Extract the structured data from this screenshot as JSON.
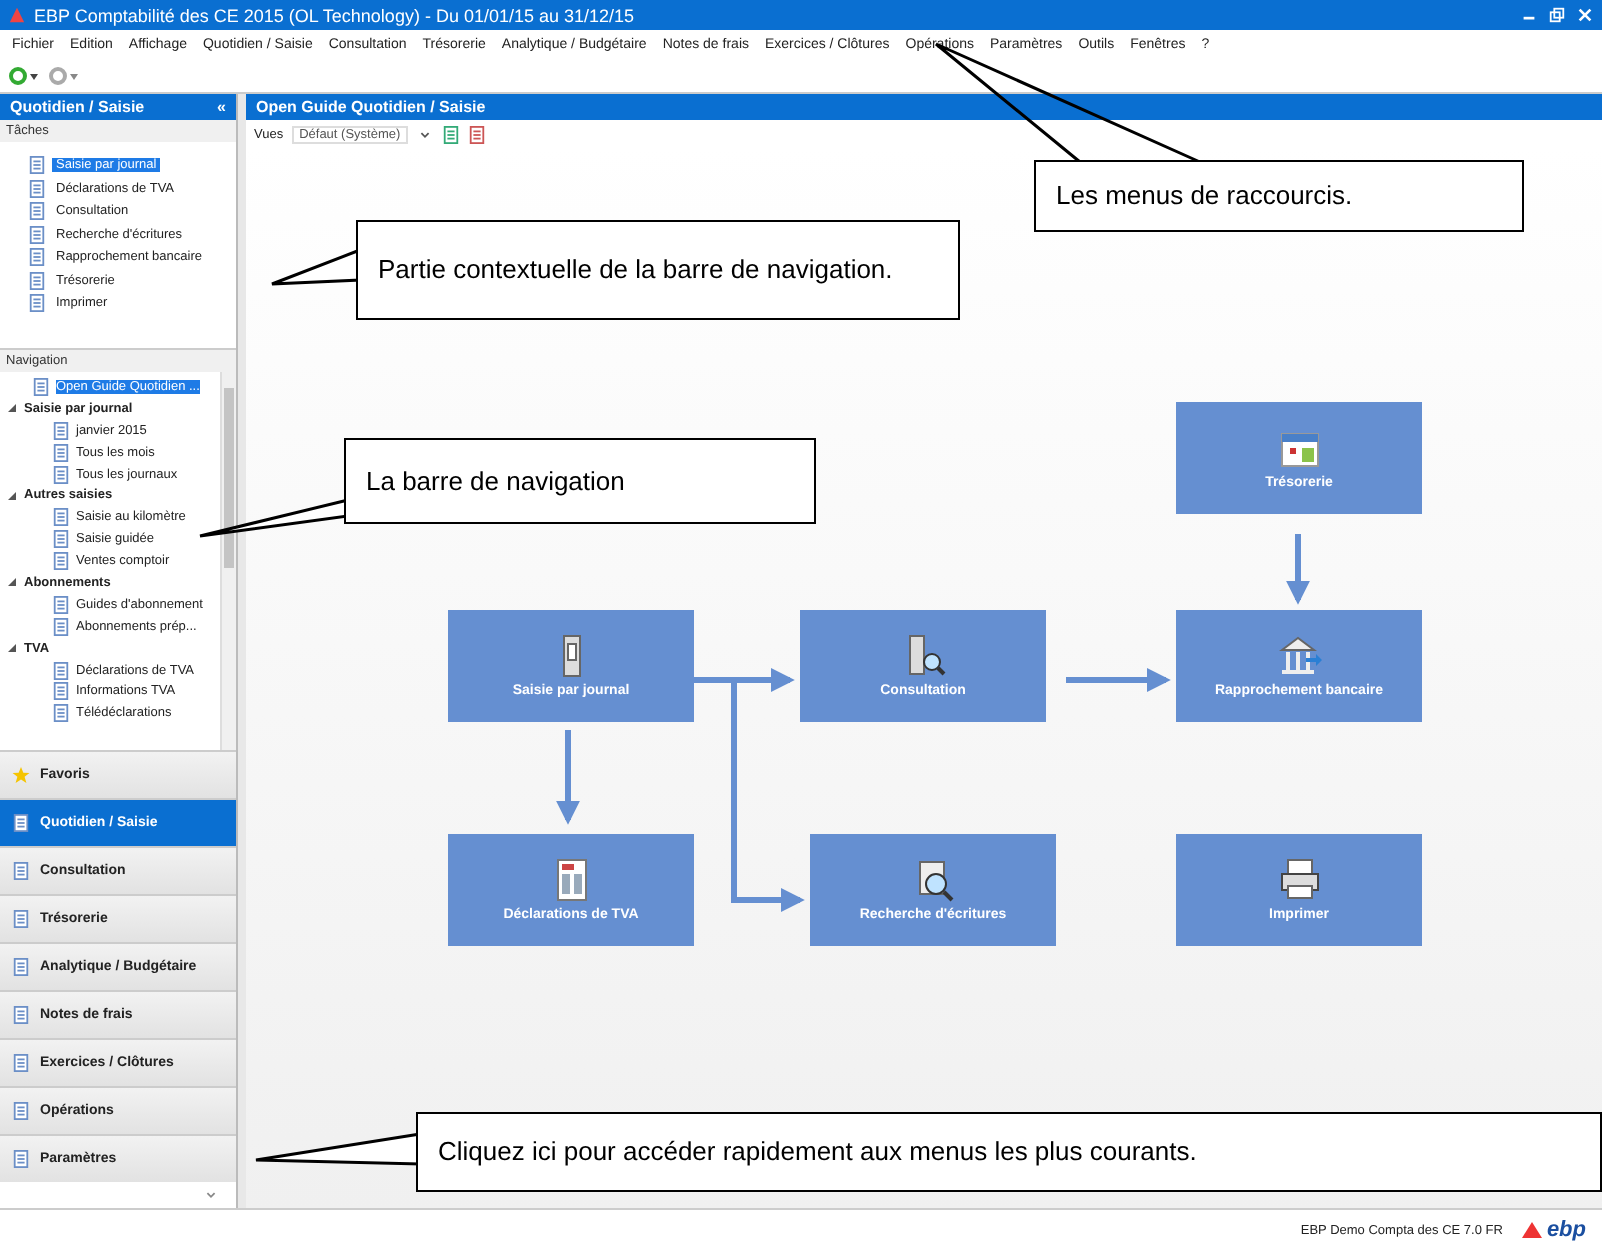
{
  "window": {
    "title": "EBP Comptabilité des CE 2015 (OL Technology) - Du 01/01/15 au 31/12/15"
  },
  "menu": [
    "Fichier",
    "Edition",
    "Affichage",
    "Quotidien / Saisie",
    "Consultation",
    "Trésorerie",
    "Analytique / Budgétaire",
    "Notes de frais",
    "Exercices / Clôtures",
    "Opérations",
    "Paramètres",
    "Outils",
    "Fenêtres",
    "?"
  ],
  "sidebar": {
    "title": "Quotidien / Saisie",
    "collapse": "«",
    "tasks_label": "Tâches",
    "tasks": [
      {
        "label": "Saisie par journal",
        "selected": true
      },
      {
        "label": "Déclarations de TVA",
        "selected": false
      },
      {
        "label": "Consultation",
        "selected": false
      },
      {
        "label": "Recherche d'écritures",
        "selected": false
      },
      {
        "label": "Rapprochement bancaire",
        "selected": false
      },
      {
        "label": "Trésorerie",
        "selected": false
      },
      {
        "label": "Imprimer",
        "selected": false
      }
    ],
    "navigation_label": "Navigation",
    "tree": [
      {
        "label": "Open Guide Quotidien ...",
        "selected": true
      },
      {
        "label": "Saisie par journal",
        "expanded": true,
        "selected": false,
        "children": [
          {
            "label": "janvier 2015",
            "selected": false
          },
          {
            "label": "Tous les mois",
            "selected": false
          },
          {
            "label": "Tous les journaux",
            "selected": false
          }
        ]
      },
      {
        "label": "Autres saisies",
        "expanded": true,
        "selected": false,
        "children": [
          {
            "label": "Saisie au kilomètre",
            "selected": false
          },
          {
            "label": "Saisie guidée",
            "selected": false
          },
          {
            "label": "Ventes comptoir",
            "selected": false
          }
        ]
      },
      {
        "label": "Abonnements",
        "expanded": true,
        "selected": false,
        "children": [
          {
            "label": "Guides d'abonnement",
            "selected": false
          },
          {
            "label": "Abonnements prép...",
            "selected": false
          }
        ]
      },
      {
        "label": "TVA",
        "expanded": true,
        "selected": false,
        "children": [
          {
            "label": "Déclarations de TVA",
            "selected": false
          },
          {
            "label": "Informations TVA",
            "selected": false
          },
          {
            "label": "Télédéclarations",
            "selected": false
          }
        ]
      }
    ],
    "buttons": [
      {
        "label": "Favoris",
        "selected": false
      },
      {
        "label": "Quotidien / Saisie",
        "selected": true
      },
      {
        "label": "Consultation",
        "selected": false
      },
      {
        "label": "Trésorerie",
        "selected": false
      },
      {
        "label": "Analytique / Budgétaire",
        "selected": false
      },
      {
        "label": "Notes de frais",
        "selected": false
      },
      {
        "label": "Exercices / Clôtures",
        "selected": false
      },
      {
        "label": "Opérations",
        "selected": false
      },
      {
        "label": "Paramètres",
        "selected": false
      }
    ]
  },
  "main": {
    "title": "Open Guide Quotidien / Saisie",
    "views_label": "Vues",
    "views_value": "Défaut (Système)",
    "nodes": [
      {
        "label": "Trésorerie"
      },
      {
        "label": "Saisie par journal"
      },
      {
        "label": "Consultation"
      },
      {
        "label": "Rapprochement bancaire"
      },
      {
        "label": "Déclarations de TVA"
      },
      {
        "label": "Recherche d'écritures"
      },
      {
        "label": "Imprimer"
      }
    ]
  },
  "status_bar": {
    "text": "EBP Demo Compta des CE 7.0 FR",
    "logo": "ebp"
  },
  "callouts": [
    {
      "text": "Les menus de raccourcis."
    },
    {
      "text": "Partie contextuelle de la barre de navigation."
    },
    {
      "text": "La barre de navigation"
    },
    {
      "text": "Cliquez ici pour accéder rapidement aux menus les plus courants."
    }
  ]
}
